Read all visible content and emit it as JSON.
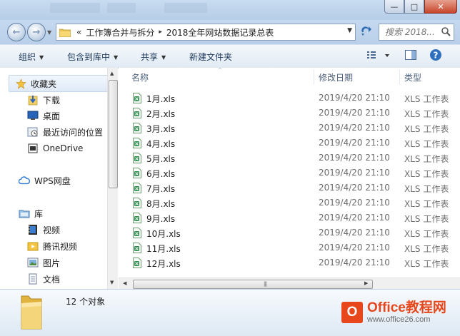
{
  "window": {
    "caption_buttons": [
      "—",
      "□",
      "✕"
    ]
  },
  "address_bar": {
    "chevrons": "«",
    "crumbs": [
      "工作簿合并与拆分",
      "2018全年网站数据记录总表"
    ],
    "separator": "▸"
  },
  "search": {
    "placeholder": "搜索 2018..."
  },
  "toolbar": {
    "organize": "组织",
    "include_in_library": "包含到库中",
    "share": "共享",
    "new_folder": "新建文件夹"
  },
  "nav_pane": {
    "favorites": "收藏夹",
    "downloads": "下载",
    "desktop": "桌面",
    "recent_places": "最近访问的位置",
    "onedrive": "OneDrive",
    "wps_cloud": "WPS网盘",
    "libraries": "库",
    "videos": "视频",
    "tencent_video": "腾讯视频",
    "pictures": "图片",
    "documents": "文档"
  },
  "columns": {
    "name": "名称",
    "date_modified": "修改日期",
    "type": "类型"
  },
  "files": [
    {
      "name": "1月.xls",
      "date": "2019/4/20 21:10",
      "type": "XLS 工作表"
    },
    {
      "name": "2月.xls",
      "date": "2019/4/20 21:10",
      "type": "XLS 工作表"
    },
    {
      "name": "3月.xls",
      "date": "2019/4/20 21:10",
      "type": "XLS 工作表"
    },
    {
      "name": "4月.xls",
      "date": "2019/4/20 21:10",
      "type": "XLS 工作表"
    },
    {
      "name": "5月.xls",
      "date": "2019/4/20 21:10",
      "type": "XLS 工作表"
    },
    {
      "name": "6月.xls",
      "date": "2019/4/20 21:10",
      "type": "XLS 工作表"
    },
    {
      "name": "7月.xls",
      "date": "2019/4/20 21:10",
      "type": "XLS 工作表"
    },
    {
      "name": "8月.xls",
      "date": "2019/4/20 21:10",
      "type": "XLS 工作表"
    },
    {
      "name": "9月.xls",
      "date": "2019/4/20 21:10",
      "type": "XLS 工作表"
    },
    {
      "name": "10月.xls",
      "date": "2019/4/20 21:10",
      "type": "XLS 工作表"
    },
    {
      "name": "11月.xls",
      "date": "2019/4/20 21:10",
      "type": "XLS 工作表"
    },
    {
      "name": "12月.xls",
      "date": "2019/4/20 21:10",
      "type": "XLS 工作表"
    }
  ],
  "details": {
    "count": "12 个对象"
  },
  "watermark": {
    "brand": "Office教程网",
    "url": "www.office26.com"
  },
  "colors": {
    "accent": "#2d6bb3",
    "brand": "#e8471b",
    "excel_green": "#2f8f4e"
  }
}
